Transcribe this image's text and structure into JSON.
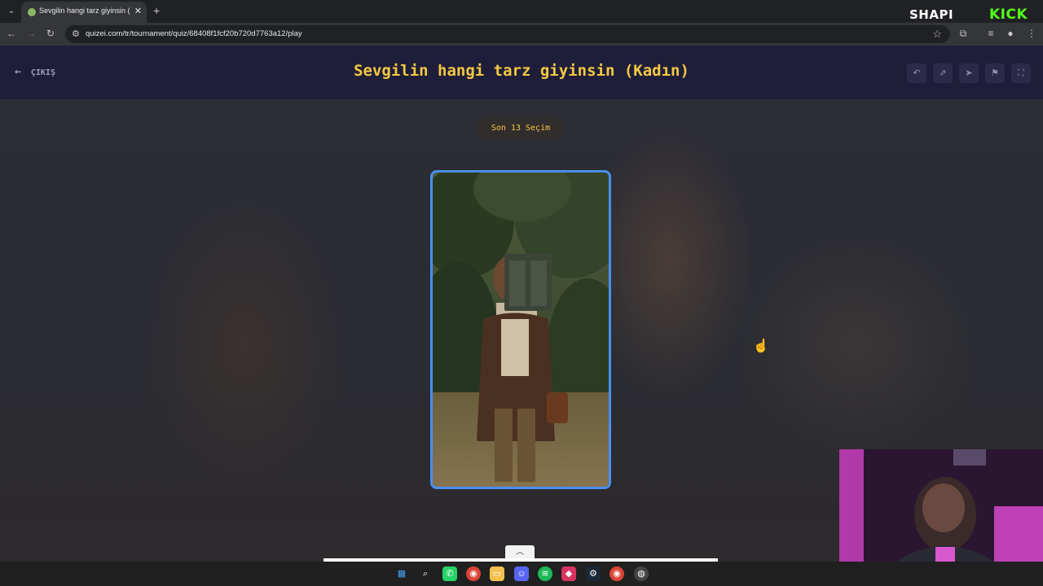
{
  "browser": {
    "tab_title": "Sevgilin hangi tarz giyinsin (Kadın)",
    "url": "quizei.com/tr/tournament/quiz/68408f1fcf20b720d7763a12/play"
  },
  "overlay": {
    "brand_left": "SHAPI",
    "brand_right": "KICK"
  },
  "header": {
    "exit_label": "ÇIKIŞ",
    "title": "Sevgilin hangi tarz giyinsin (Kadın)"
  },
  "round_label": "Son 13 Seçim",
  "colors": {
    "accent": "#f5c842",
    "card_border": "#4a8ff2",
    "header_bg": "#1f1e3a",
    "kick_green": "#53fc18"
  }
}
